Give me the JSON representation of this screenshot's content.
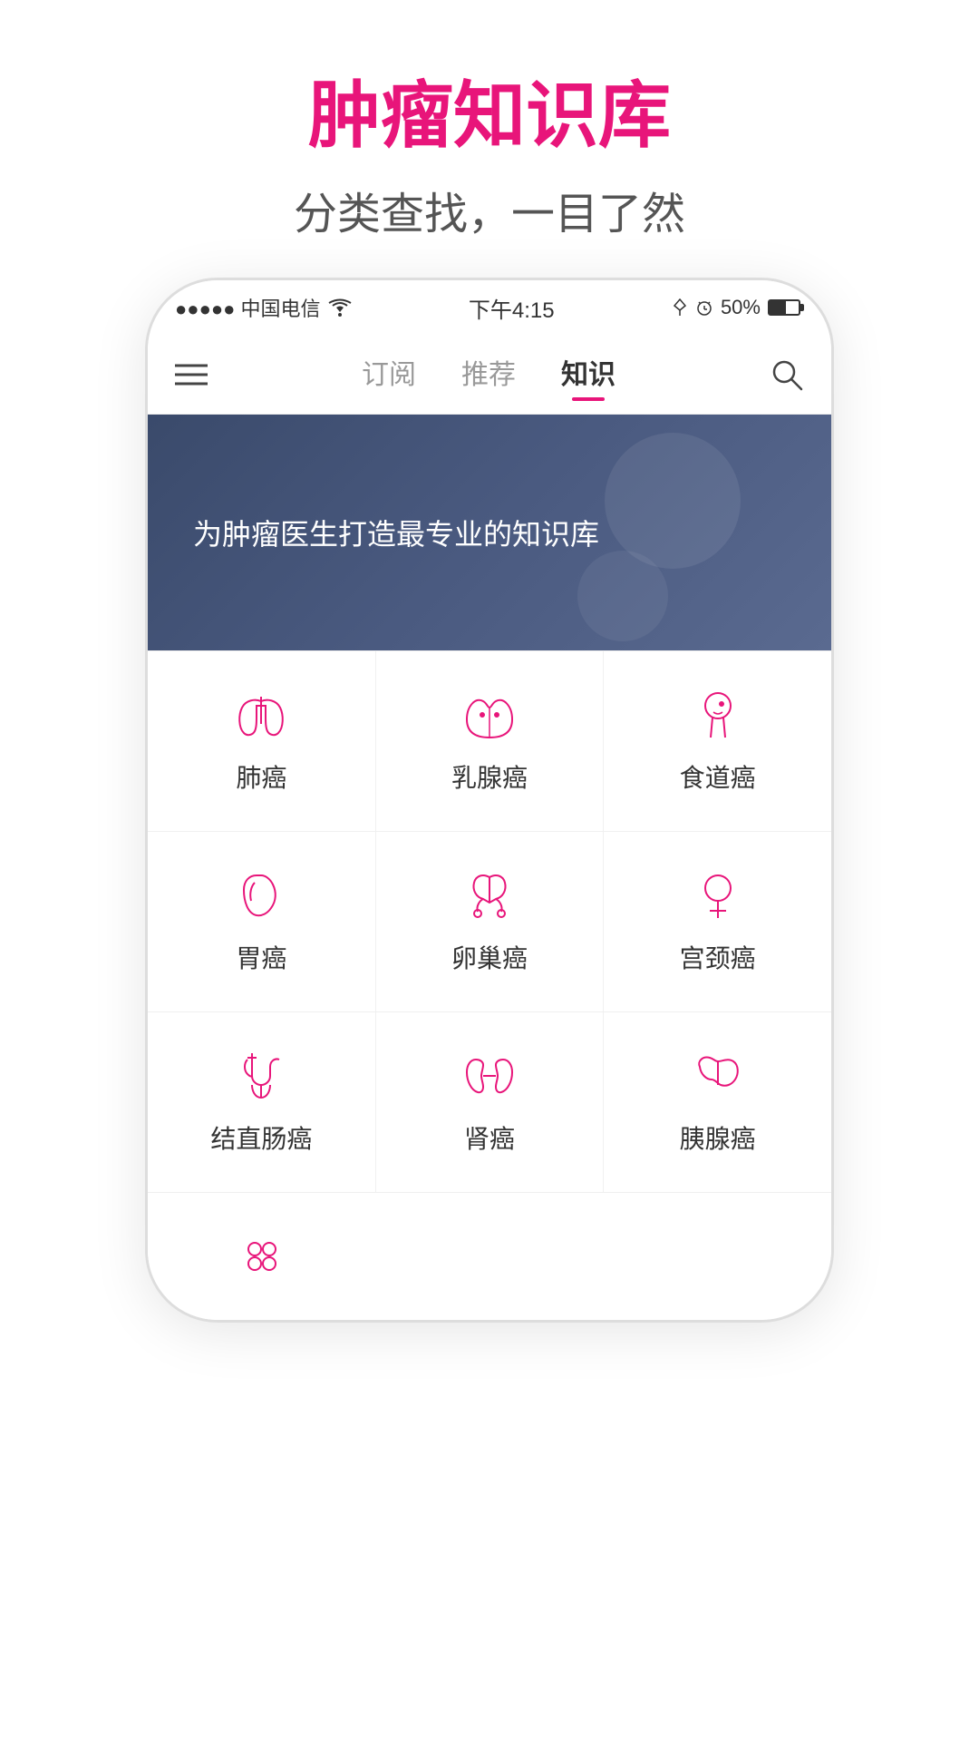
{
  "page": {
    "title": "肿瘤知识库",
    "subtitle": "分类查找，一目了然"
  },
  "status_bar": {
    "carrier": "●●●●● 中国电信",
    "wifi": "WiFi",
    "time": "下午4:15",
    "battery": "50%"
  },
  "nav": {
    "tabs": [
      {
        "label": "订阅",
        "active": false
      },
      {
        "label": "推荐",
        "active": false
      },
      {
        "label": "知识",
        "active": true
      }
    ]
  },
  "banner": {
    "text": "为肿瘤医生打造最专业的知识库"
  },
  "grid": [
    {
      "id": "lung",
      "label": "肺癌",
      "icon": "lung"
    },
    {
      "id": "breast",
      "label": "乳腺癌",
      "icon": "breast"
    },
    {
      "id": "esophagus",
      "label": "食道癌",
      "icon": "esophagus"
    },
    {
      "id": "stomach",
      "label": "胃癌",
      "icon": "stomach"
    },
    {
      "id": "ovary",
      "label": "卵巢癌",
      "icon": "ovary"
    },
    {
      "id": "cervix",
      "label": "宫颈癌",
      "icon": "cervix"
    },
    {
      "id": "colon",
      "label": "结直肠癌",
      "icon": "colon"
    },
    {
      "id": "kidney",
      "label": "肾癌",
      "icon": "kidney"
    },
    {
      "id": "pancreas",
      "label": "胰腺癌",
      "icon": "pancreas"
    },
    {
      "id": "more",
      "label": "",
      "icon": "more"
    }
  ]
}
